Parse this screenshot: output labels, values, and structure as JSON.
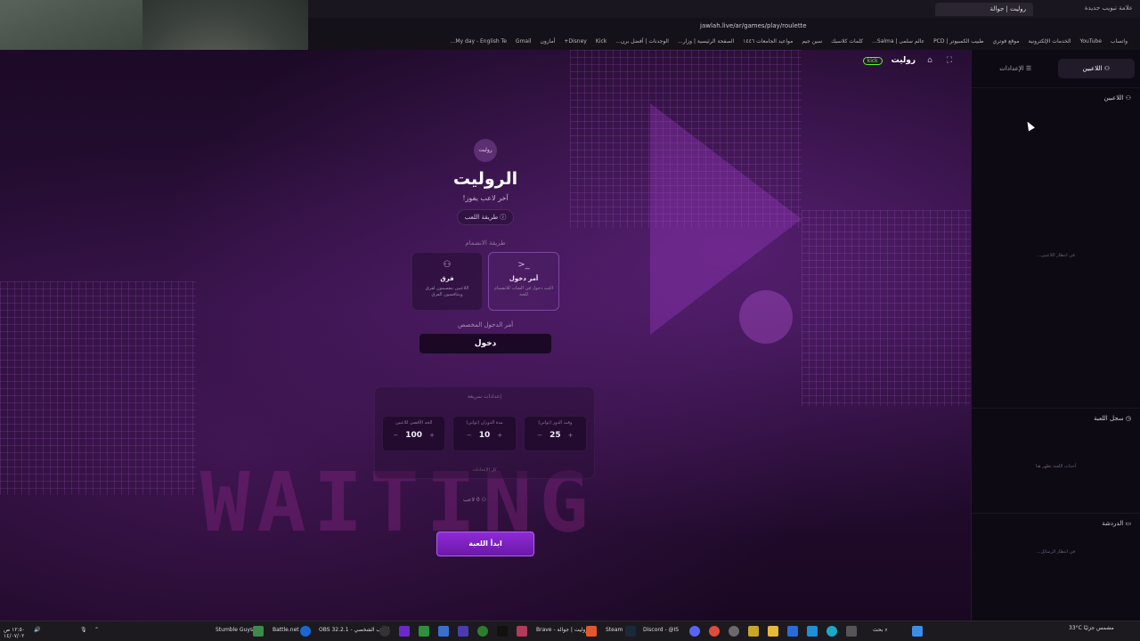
{
  "browser": {
    "tab_active": "روليت | جوالة",
    "tab_new": "علامة تبويب جديدة",
    "url": "jawlah.live/ar/games/play/roulette",
    "bookmarks": [
      "واتساب",
      "YouTube",
      "الخدمات الإلكترونية",
      "موقع فوتري",
      "طبيب الكمبيوتر | PCD",
      "عالم سلمى | Salma...",
      "كلمات كلاسيك",
      "سين جيم",
      "مواعيد الجامعات ١٤٤٦",
      "الصفحة الرئيسية | وزار...",
      "الوجدنات | أفضل برن...",
      "Kick",
      "Disney+",
      "أمازون",
      "Gmail",
      "My day - English Te..."
    ]
  },
  "game": {
    "brand": "روليت",
    "kick": "kick",
    "logo_text": "روليت",
    "title": "الروليت",
    "subtitle": "آخر لاعب يفوز!",
    "how_to_play": "طريقة اللعب",
    "join_method_label": "طريقة الانضمام",
    "modes": [
      {
        "title": "أمر دخول",
        "desc": "اكتب دخول في الشات للانضمام للعبة",
        "icon": "terminal-icon",
        "active": true
      },
      {
        "title": "فرق",
        "desc": "اللاعبين ينقسمون لفرق ويتنافسون الفرق",
        "icon": "users-icon",
        "active": false
      }
    ],
    "custom_cmd_label": "أمر الدخول المخصص",
    "custom_cmd_value": "دخول",
    "quick_settings_title": "إعدادات سريعة",
    "settings": [
      {
        "label": "وقت الدور (ثواني)",
        "value": "25"
      },
      {
        "label": "مدة الدوران (ثواني)",
        "value": "10"
      },
      {
        "label": "الحد الأقصى للاعبين",
        "value": "100"
      }
    ],
    "all_settings": "كل الإعدادات",
    "players_count": "0 لاعب",
    "start_button": "ابدأ اللعبة",
    "bg_text": "WAITING"
  },
  "sidebar": {
    "tab_players": "اللاعبين",
    "tab_settings": "الإعدادات",
    "players_head": "اللاعبين",
    "players_empty": "في انتظار اللاعبين...",
    "log_head": "سجل اللعبة",
    "log_empty": "أحداث اللعبة تظهر هنا",
    "chat_head": "الدردشة",
    "chat_empty": "في انتظار الرسائل..."
  },
  "taskbar": {
    "items": [
      "Stumble Guys",
      "Battle.net",
      "OBS 32.2.1 - الملف الشخصي",
      "Brave - روليت | جوالة",
      "Steam",
      "Discord - @IS"
    ],
    "search": "بحث",
    "weather": "33°C مشمس جزئيًا",
    "time": "١٢:٥٠ ص",
    "date": "١٤/٠٧/٠٢"
  }
}
